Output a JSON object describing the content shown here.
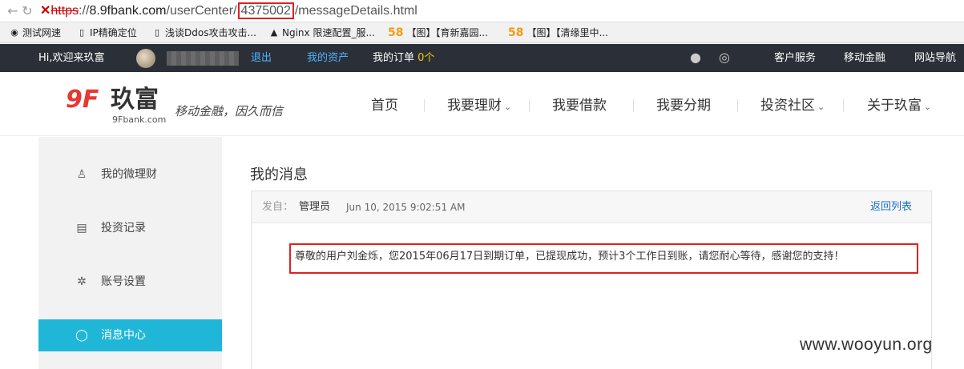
{
  "browser": {
    "url_cross": "✕",
    "url_scheme": "https",
    "url_sep": "://",
    "url_domain": "8.9fbank.com",
    "url_path1": "/userCenter/",
    "url_id": "4375002",
    "url_path2": "/messageDetails.html",
    "bookmarks": [
      {
        "label": "测试网速",
        "icon": "eye-icon"
      },
      {
        "label": "IP精确定位",
        "icon": "page-icon"
      },
      {
        "label": "浅谈Ddos攻击攻击...",
        "icon": "page-icon"
      },
      {
        "label": "Nginx 限速配置_服...",
        "icon": "penguin-icon"
      },
      {
        "num": "58",
        "label": "【图】【育新嘉园..."
      },
      {
        "num": "58",
        "label": "【图】【清缘里中..."
      }
    ]
  },
  "topbar": {
    "greeting": "Hi,欢迎来玖富",
    "logout": "退出",
    "my_assets": "我的资产",
    "my_orders_label": "我的订单",
    "my_orders_count": "0个",
    "customer_service": "客户服务",
    "mobile_finance": "移动金融",
    "site_nav": "网站导航"
  },
  "header": {
    "logo_mark": "9F",
    "logo_name": "玖富",
    "logo_domain": "9Fbank.com",
    "slogan": "移动金融，因久而信",
    "menu": [
      {
        "label": "首页",
        "has_caret": false
      },
      {
        "label": "我要理财",
        "has_caret": true
      },
      {
        "label": "我要借款",
        "has_caret": false
      },
      {
        "label": "我要分期",
        "has_caret": false
      },
      {
        "label": "投资社区",
        "has_caret": true
      },
      {
        "label": "关于玖富",
        "has_caret": true
      }
    ],
    "caret": "⌄"
  },
  "sidebar": {
    "items": [
      {
        "label": "我的微理财",
        "icon": "user-icon",
        "active": false
      },
      {
        "label": "投资记录",
        "icon": "list-icon",
        "active": false
      },
      {
        "label": "账号设置",
        "icon": "gear-icon",
        "active": false
      },
      {
        "label": "消息中心",
        "icon": "chat-icon",
        "active": true
      }
    ]
  },
  "main": {
    "title": "我的消息",
    "from_label": "发自：",
    "from": "管理员",
    "date": "Jun 10, 2015 9:02:51 AM",
    "back": "返回列表",
    "message": "尊敬的用户刘金烁，您2015年06月17日到期订单，已提现成功，预计3个工作日到账，请您耐心等待，感谢您的支持！"
  },
  "watermark": "www.wooyun.org",
  "colors": {
    "topbar_bg": "#2b3038",
    "accent_cyan": "#1fb6d8",
    "link_blue": "#1a6fc4",
    "brand_red": "#e8382f",
    "highlight_red": "#e02020"
  }
}
